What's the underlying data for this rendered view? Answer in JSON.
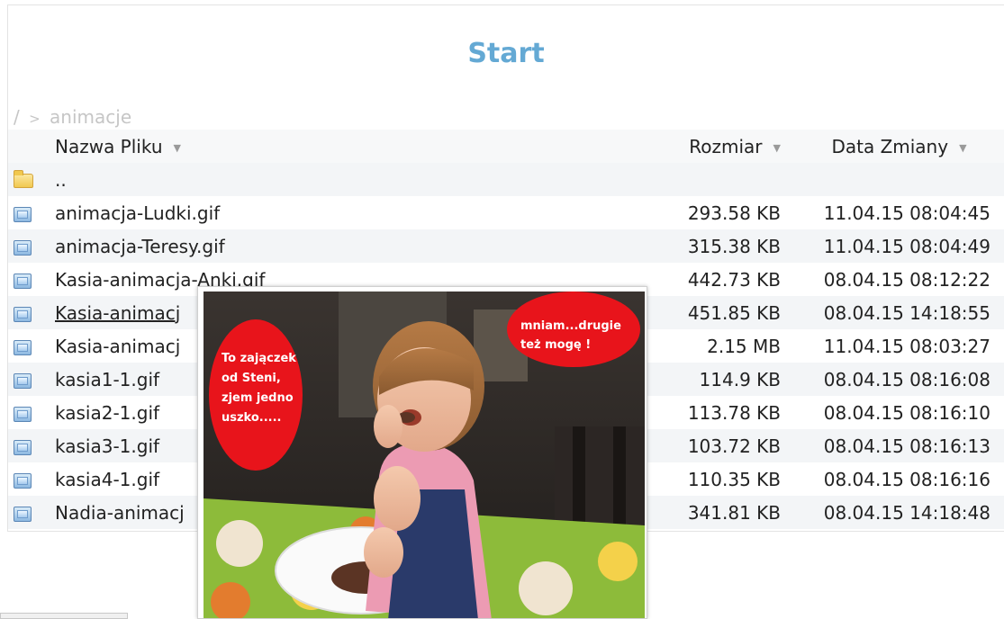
{
  "page": {
    "title": "Start",
    "breadcrumb": {
      "root": "/",
      "separator": ">",
      "current": "animacje"
    }
  },
  "table": {
    "headers": {
      "name": "Nazwa Pliku",
      "size": "Rozmiar",
      "date": "Data Zmiany"
    },
    "parent_label": "..",
    "rows": [
      {
        "name": "animacja-Ludki.gif",
        "size": "293.58 KB",
        "date": "11.04.15 08:04:45"
      },
      {
        "name": "animacja-Teresy.gif",
        "size": "315.38 KB",
        "date": "11.04.15 08:04:49"
      },
      {
        "name": "Kasia-animacja-Anki.gif",
        "size": "442.73 KB",
        "date": "08.04.15 08:12:22"
      },
      {
        "name": "Kasia-animacj",
        "size": "451.85 KB",
        "date": "08.04.15 14:18:55"
      },
      {
        "name": "Kasia-animacj",
        "size": "2.15 MB",
        "date": "11.04.15 08:03:27"
      },
      {
        "name": "kasia1-1.gif",
        "size": "114.9 KB",
        "date": "08.04.15 08:16:08"
      },
      {
        "name": "kasia2-1.gif",
        "size": "113.78 KB",
        "date": "08.04.15 08:16:10"
      },
      {
        "name": "kasia3-1.gif",
        "size": "103.72 KB",
        "date": "08.04.15 08:16:13"
      },
      {
        "name": "kasia4-1.gif",
        "size": "110.35 KB",
        "date": "08.04.15 08:16:16"
      },
      {
        "name": "Nadia-animacj",
        "size": "341.81 KB",
        "date": "08.04.15 14:18:48"
      }
    ]
  },
  "preview": {
    "bubble_left": [
      "To zajączek",
      "od Steni,",
      "zjem jedno",
      "uszko....."
    ],
    "bubble_right": [
      "mniam...drugie",
      "też mogę !"
    ]
  },
  "icons": {
    "folder": "folder-icon",
    "file": "image-file-icon",
    "sort": "sort-arrow-icon"
  },
  "colors": {
    "title": "#64a9d4",
    "breadcrumb": "#c6c6c6",
    "bubble": "#e8141b"
  }
}
